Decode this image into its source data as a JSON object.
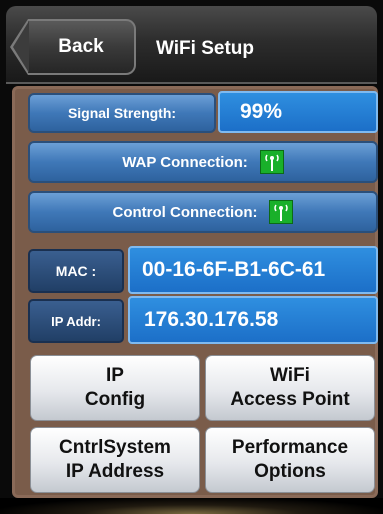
{
  "header": {
    "back_label": "Back",
    "title": "WiFi Setup"
  },
  "status": {
    "signal_label": "Signal Strength:",
    "signal_value": "99%",
    "wap_label": "WAP Connection:",
    "wap_icon": "antenna-icon",
    "control_label": "Control Connection:",
    "control_icon": "antenna-icon",
    "mac_label": "MAC :",
    "mac_value": "00-16-6F-B1-6C-61",
    "ip_label": "IP Addr:",
    "ip_value": "176.30.176.58"
  },
  "buttons": {
    "ip_config": [
      "IP",
      "Config"
    ],
    "wifi_ap": [
      "WiFi",
      "Access Point"
    ],
    "cntrl_ip": [
      "CntrlSystem",
      "IP Address"
    ],
    "perf": [
      "Performance",
      "Options"
    ]
  },
  "colors": {
    "accent_blue": "#2f8fe0",
    "status_green": "#19b02a"
  }
}
